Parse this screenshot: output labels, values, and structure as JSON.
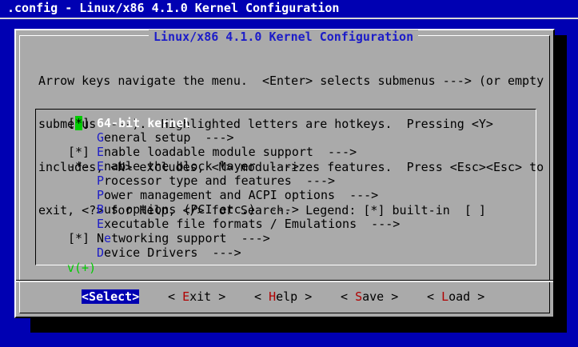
{
  "window_title": ".config - Linux/x86 4.1.0 Kernel Configuration",
  "dialog": {
    "title": "Linux/x86 4.1.0 Kernel Configuration",
    "help_lines": [
      "Arrow keys navigate the menu.  <Enter> selects submenus ---> (or empty",
      "submenus ----).  Highlighted letters are hotkeys.  Pressing <Y>",
      "includes, <N> excludes, <M> modularizes features.  Press <Esc><Esc> to",
      "exit, <?> for Help, </> for Search.  Legend: [*] built-in  [ ]"
    ]
  },
  "menu": {
    "items": [
      {
        "prefix": "[*]",
        "hot": "6",
        "rest": "4-bit kernel",
        "selected": true
      },
      {
        "prefix": "",
        "hot": "G",
        "rest": "eneral setup  --->"
      },
      {
        "prefix": "[*]",
        "hot": "E",
        "rest": "nable loadable module support  --->"
      },
      {
        "prefix": "-*-",
        "hot": "E",
        "rest": "nable the block layer  --->"
      },
      {
        "prefix": "",
        "hot": "P",
        "rest": "rocessor type and features  --->"
      },
      {
        "prefix": "",
        "hot": "P",
        "rest": "ower management and ACPI options  --->"
      },
      {
        "prefix": "",
        "hot": "B",
        "rest": "us options (PCI etc.)  --->"
      },
      {
        "prefix": "",
        "hot": "E",
        "rest": "xecutable file formats / Emulations  --->"
      },
      {
        "prefix": "[*]",
        "pre": "N",
        "hot": "e",
        "rest": "tworking support  --->"
      },
      {
        "prefix": "",
        "hot": "D",
        "rest": "evice Drivers  --->"
      }
    ],
    "scroll_indicator": "v(+)"
  },
  "buttons": [
    {
      "open": "<",
      "hot": "S",
      "rest": "elect",
      "close": ">",
      "active": true
    },
    {
      "open": "< ",
      "hot": "E",
      "rest": "xit",
      "close": " >"
    },
    {
      "open": "< ",
      "hot": "H",
      "rest": "elp",
      "close": " >"
    },
    {
      "open": "< ",
      "hot": "S",
      "rest": "ave",
      "close": " >"
    },
    {
      "open": "< ",
      "hot": "L",
      "rest": "oad",
      "close": " >"
    }
  ],
  "colors": {
    "background": "#0000b2",
    "dialog": "#aaaaaa",
    "hotkey": "#1c1cc8",
    "button_hotkey": "#b00000",
    "selection_cursor": "#00cc00"
  }
}
